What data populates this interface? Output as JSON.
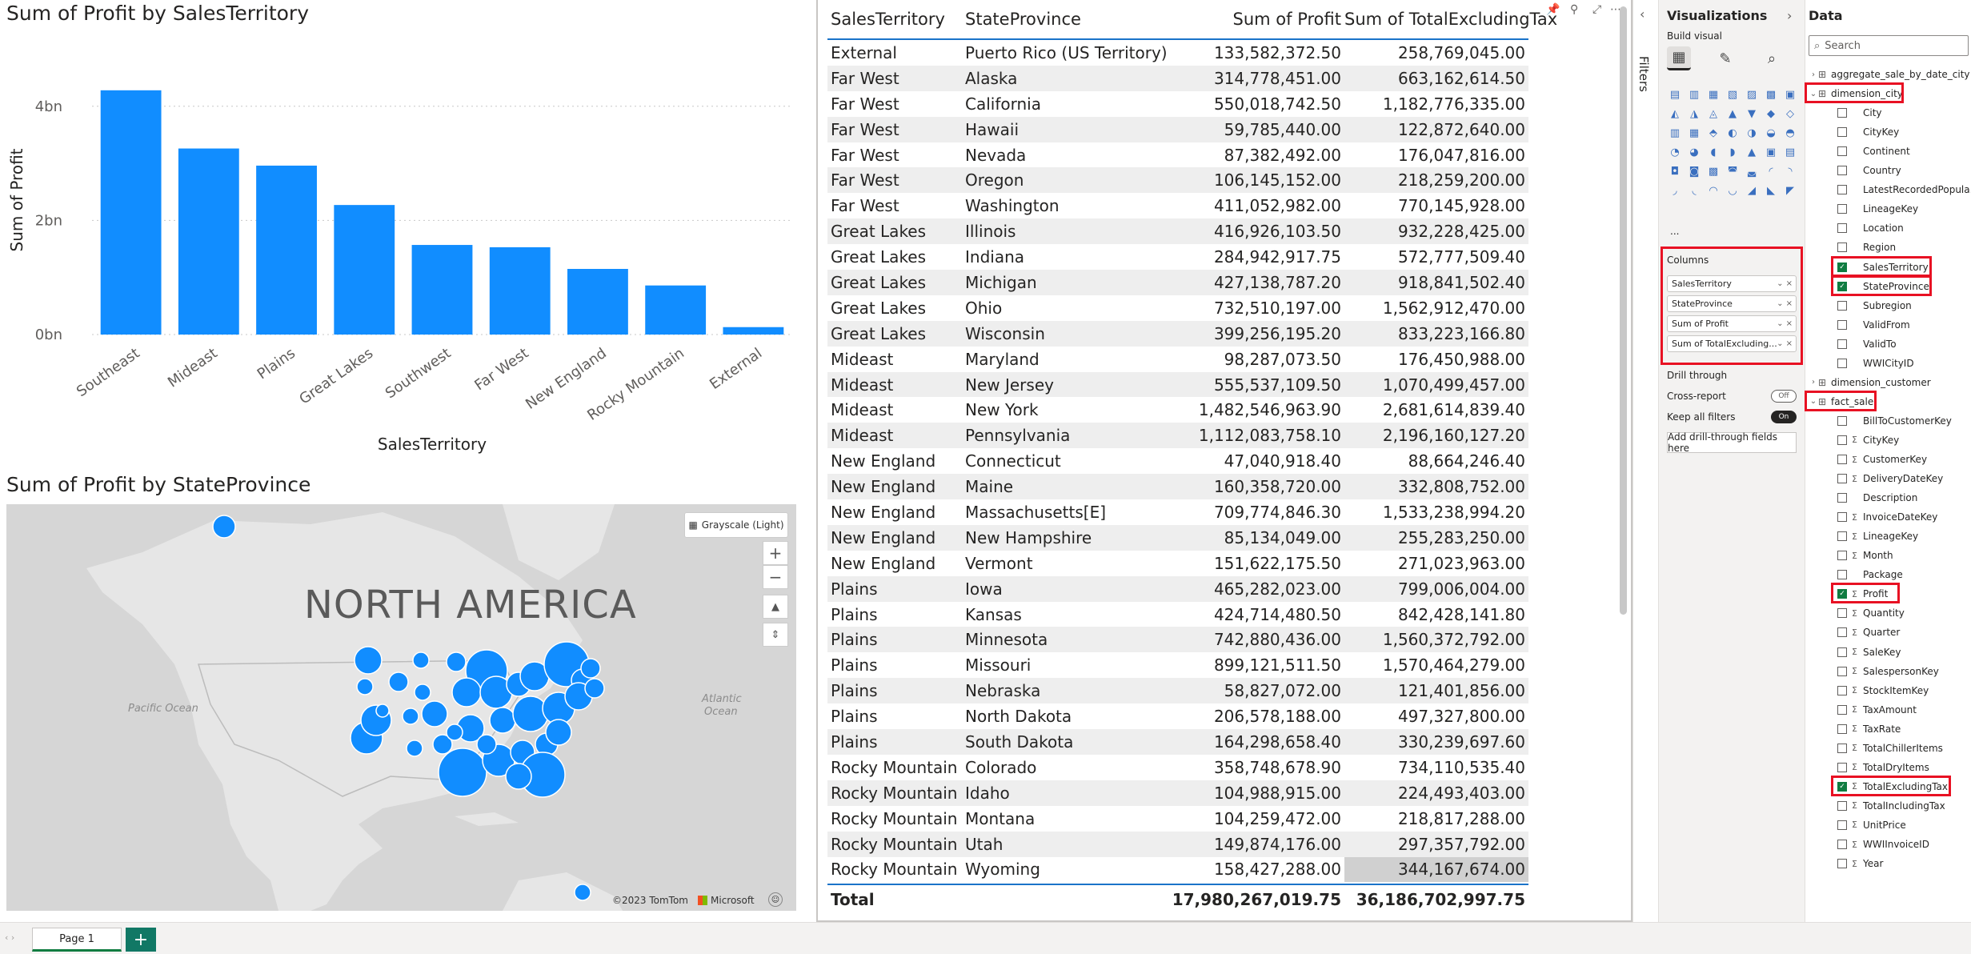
{
  "bar_chart": {
    "title": "Sum of Profit by SalesTerritory",
    "chart_data": {
      "type": "bar",
      "title": "Sum of Profit by SalesTerritory",
      "xlabel": "SalesTerritory",
      "ylabel": "Sum of Profit",
      "categories": [
        "Southeast",
        "Mideast",
        "Plains",
        "Great Lakes",
        "Southwest",
        "Far West",
        "New England",
        "Rocky Mountain",
        "External"
      ],
      "values": [
        4.28,
        3.26,
        2.96,
        2.27,
        1.57,
        1.53,
        1.15,
        0.86,
        0.13
      ],
      "yticks": [
        "0bn",
        "2bn",
        "4bn"
      ],
      "ytick_values": [
        0,
        2,
        4
      ],
      "ylim": [
        0,
        4.6
      ],
      "grid": true,
      "bar_color": "#118dff"
    }
  },
  "map_visual": {
    "title": "Sum of Profit by StateProvince",
    "continent_label": "NORTH AMERICA",
    "ocean_left": "Pacific Ocean",
    "ocean_right_1": "Atlantic",
    "ocean_right_2": "Ocean",
    "style_button": "Grayscale (Light)",
    "zoom_in": "+",
    "zoom_out": "−",
    "copyright": "©2023 TomTom",
    "microsoft": "Microsoft",
    "bubble_color": "#118dff"
  },
  "table": {
    "headers": [
      "SalesTerritory",
      "StateProvince",
      "Sum of Profit",
      "Sum of TotalExcludingTax"
    ],
    "rows": [
      [
        "External",
        "Puerto Rico (US Territory)",
        "133,582,372.50",
        "258,769,045.00"
      ],
      [
        "Far West",
        "Alaska",
        "314,778,451.00",
        "663,162,614.50"
      ],
      [
        "Far West",
        "California",
        "550,018,742.50",
        "1,182,776,335.00"
      ],
      [
        "Far West",
        "Hawaii",
        "59,785,440.00",
        "122,872,640.00"
      ],
      [
        "Far West",
        "Nevada",
        "87,382,492.00",
        "176,047,816.00"
      ],
      [
        "Far West",
        "Oregon",
        "106,145,152.00",
        "218,259,200.00"
      ],
      [
        "Far West",
        "Washington",
        "411,052,982.00",
        "770,145,928.00"
      ],
      [
        "Great Lakes",
        "Illinois",
        "416,926,103.50",
        "932,228,425.00"
      ],
      [
        "Great Lakes",
        "Indiana",
        "284,942,917.75",
        "572,777,509.40"
      ],
      [
        "Great Lakes",
        "Michigan",
        "427,138,787.20",
        "918,841,502.40"
      ],
      [
        "Great Lakes",
        "Ohio",
        "732,510,197.00",
        "1,562,912,470.00"
      ],
      [
        "Great Lakes",
        "Wisconsin",
        "399,256,195.20",
        "833,223,166.80"
      ],
      [
        "Mideast",
        "Maryland",
        "98,287,073.50",
        "176,450,988.00"
      ],
      [
        "Mideast",
        "New Jersey",
        "555,537,109.50",
        "1,070,499,457.00"
      ],
      [
        "Mideast",
        "New York",
        "1,482,546,963.90",
        "2,681,614,839.40"
      ],
      [
        "Mideast",
        "Pennsylvania",
        "1,112,083,758.10",
        "2,196,160,127.20"
      ],
      [
        "New England",
        "Connecticut",
        "47,040,918.40",
        "88,664,246.40"
      ],
      [
        "New England",
        "Maine",
        "160,358,720.00",
        "332,808,752.00"
      ],
      [
        "New England",
        "Massachusetts[E]",
        "709,774,846.30",
        "1,533,238,994.20"
      ],
      [
        "New England",
        "New Hampshire",
        "85,134,049.00",
        "255,283,250.00"
      ],
      [
        "New England",
        "Vermont",
        "151,622,175.50",
        "271,023,963.00"
      ],
      [
        "Plains",
        "Iowa",
        "465,282,023.00",
        "799,006,004.00"
      ],
      [
        "Plains",
        "Kansas",
        "424,714,480.50",
        "842,428,141.80"
      ],
      [
        "Plains",
        "Minnesota",
        "742,880,436.00",
        "1,560,372,792.00"
      ],
      [
        "Plains",
        "Missouri",
        "899,121,511.50",
        "1,570,464,279.00"
      ],
      [
        "Plains",
        "Nebraska",
        "58,827,072.00",
        "121,401,856.00"
      ],
      [
        "Plains",
        "North Dakota",
        "206,578,188.00",
        "497,327,800.00"
      ],
      [
        "Plains",
        "South Dakota",
        "164,298,658.40",
        "330,239,697.60"
      ],
      [
        "Rocky Mountain",
        "Colorado",
        "358,748,678.90",
        "734,110,535.40"
      ],
      [
        "Rocky Mountain",
        "Idaho",
        "104,988,915.00",
        "224,493,403.00"
      ],
      [
        "Rocky Mountain",
        "Montana",
        "104,259,472.00",
        "218,817,288.00"
      ],
      [
        "Rocky Mountain",
        "Utah",
        "149,874,176.00",
        "297,357,792.00"
      ],
      [
        "Rocky Mountain",
        "Wyoming",
        "158,427,288.00",
        "344,167,674.00"
      ]
    ],
    "total_label": "Total",
    "total_profit": "17,980,267,019.75",
    "total_excl_tax": "36,186,702,997.75"
  },
  "filters": {
    "label": "Filters"
  },
  "visualizations": {
    "title": "Visualizations",
    "build_label": "Build visual",
    "columns_label": "Columns",
    "wells": [
      "SalesTerritory",
      "StateProvince",
      "Sum of Profit",
      "Sum of TotalExcluding..."
    ],
    "drill_through": "Drill through",
    "cross_report": "Cross-report",
    "cross_report_state": "Off",
    "keep_filters": "Keep all filters",
    "keep_filters_state": "On",
    "drill_field": "Add drill-through fields here",
    "more": "..."
  },
  "data_pane": {
    "title": "Data",
    "search_placeholder": "Search",
    "tables": [
      {
        "name": "aggregate_sale_by_date_city",
        "expanded": false
      },
      {
        "name": "dimension_city",
        "expanded": true
      },
      {
        "name": "dimension_customer",
        "expanded": false
      },
      {
        "name": "fact_sale",
        "expanded": true
      }
    ],
    "dimension_city_fields": [
      "City",
      "CityKey",
      "Continent",
      "Country",
      "LatestRecordedPopula...",
      "LineageKey",
      "Location",
      "Region",
      "SalesTerritory",
      "StateProvince",
      "Subregion",
      "ValidFrom",
      "ValidTo",
      "WWICityID"
    ],
    "fact_sale_fields": [
      "BillToCustomerKey",
      "CityKey",
      "CustomerKey",
      "DeliveryDateKey",
      "Description",
      "InvoiceDateKey",
      "LineageKey",
      "Month",
      "Package",
      "Profit",
      "Quantity",
      "Quarter",
      "SaleKey",
      "SalespersonKey",
      "StockItemKey",
      "TaxAmount",
      "TaxRate",
      "TotalChillerItems",
      "TotalDryItems",
      "TotalExcludingTax",
      "TotalIncludingTax",
      "UnitPrice",
      "WWIInvoiceID",
      "Year"
    ]
  },
  "page_tabs": {
    "page_label": "Page 1",
    "add_label": "+"
  }
}
